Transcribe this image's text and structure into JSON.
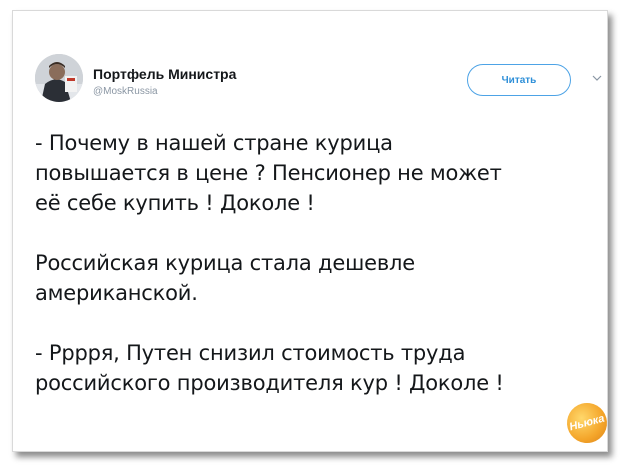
{
  "tweet": {
    "author_name": "Портфель Министра",
    "author_handle": "@MoskRussia",
    "follow_label": "Читать",
    "paragraphs": [
      "- Почему в нашей стране курица\nповышается в цене ? Пенсионер не может\nеё себе купить ! Доколе !",
      "Российская курица стала дешевле\nамериканской.",
      "- Рррря, Путен снизил стоимость труда\nроссийского производителя кур ! Доколе !"
    ]
  },
  "watermark": {
    "text": "Ньюка"
  },
  "icons": {
    "more": "chevron-down-icon",
    "avatar": "avatar"
  },
  "colors": {
    "accent": "#2e8fd8",
    "text": "#14171a",
    "muted": "#8a96a3",
    "watermark": "#f4a52a"
  }
}
